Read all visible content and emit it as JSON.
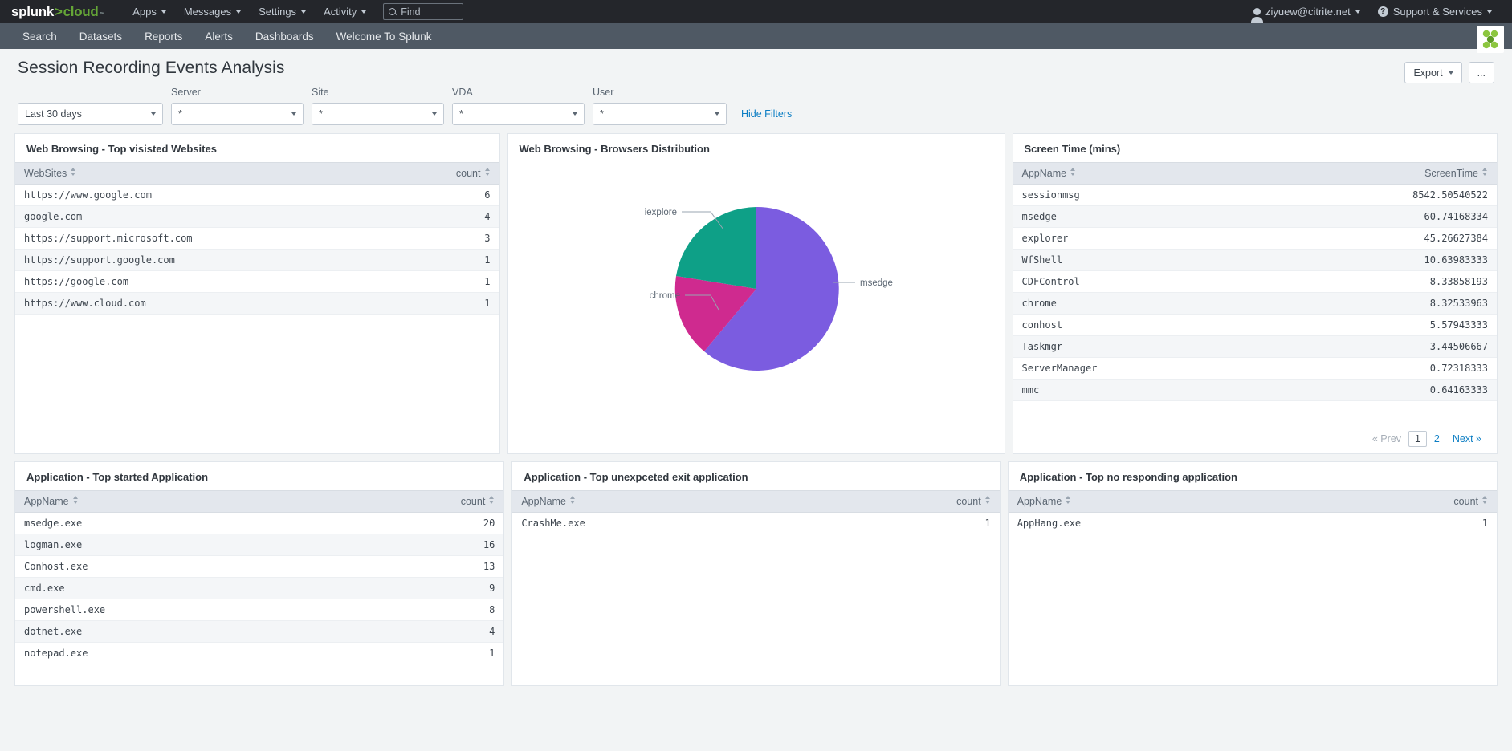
{
  "topbar": {
    "logo": {
      "part1": "splunk",
      "gt": ">",
      "part2": "cloud",
      "tm": "™"
    },
    "menus": [
      {
        "name": "apps",
        "label": "Apps"
      },
      {
        "name": "messages",
        "label": "Messages"
      },
      {
        "name": "settings",
        "label": "Settings"
      },
      {
        "name": "activity",
        "label": "Activity"
      }
    ],
    "find_placeholder": "Find",
    "user": "ziyuew@citrite.net",
    "support": "Support & Services"
  },
  "appnav": {
    "items": [
      {
        "name": "search",
        "label": "Search"
      },
      {
        "name": "datasets",
        "label": "Datasets"
      },
      {
        "name": "reports",
        "label": "Reports"
      },
      {
        "name": "alerts",
        "label": "Alerts"
      },
      {
        "name": "dashboards",
        "label": "Dashboards"
      },
      {
        "name": "welcome",
        "label": "Welcome To Splunk"
      }
    ]
  },
  "page": {
    "title": "Session Recording Events Analysis",
    "export_label": "Export",
    "more_label": "..."
  },
  "filters": {
    "time": {
      "label": "",
      "value": "Last 30 days"
    },
    "server": {
      "label": "Server",
      "value": "*"
    },
    "site": {
      "label": "Site",
      "value": "*"
    },
    "vda": {
      "label": "VDA",
      "value": "*"
    },
    "user": {
      "label": "User",
      "value": "*"
    },
    "hide_filters": "Hide Filters"
  },
  "panels": {
    "top_websites": {
      "title": "Web Browsing - Top visisted Websites",
      "columns": [
        "WebSites",
        "count"
      ],
      "rows": [
        [
          "https://www.google.com",
          "6"
        ],
        [
          "google.com",
          "4"
        ],
        [
          "https://support.microsoft.com",
          "3"
        ],
        [
          "https://support.google.com",
          "1"
        ],
        [
          "https://google.com",
          "1"
        ],
        [
          "https://www.cloud.com",
          "1"
        ]
      ]
    },
    "browsers": {
      "title": "Web Browsing - Browsers Distribution"
    },
    "screen_time": {
      "title": "Screen Time (mins)",
      "columns": [
        "AppName",
        "ScreenTime"
      ],
      "rows": [
        [
          "sessionmsg",
          "8542.50540522"
        ],
        [
          "msedge",
          "60.74168334"
        ],
        [
          "explorer",
          "45.26627384"
        ],
        [
          "WfShell",
          "10.63983333"
        ],
        [
          "CDFControl",
          "8.33858193"
        ],
        [
          "chrome",
          "8.32533963"
        ],
        [
          "conhost",
          "5.57943333"
        ],
        [
          "Taskmgr",
          "3.44506667"
        ],
        [
          "ServerManager",
          "0.72318333"
        ],
        [
          "mmc",
          "0.64163333"
        ]
      ],
      "pager": {
        "prev": "« Prev",
        "pages": [
          "1",
          "2"
        ],
        "current": "1",
        "next": "Next »"
      }
    },
    "top_started": {
      "title": "Application - Top started Application",
      "columns": [
        "AppName",
        "count"
      ],
      "rows": [
        [
          "msedge.exe",
          "20"
        ],
        [
          "logman.exe",
          "16"
        ],
        [
          "Conhost.exe",
          "13"
        ],
        [
          "cmd.exe",
          "9"
        ],
        [
          "powershell.exe",
          "8"
        ],
        [
          "dotnet.exe",
          "4"
        ],
        [
          "notepad.exe",
          "1"
        ]
      ]
    },
    "unexpected_exit": {
      "title": "Application - Top unexpceted exit application",
      "columns": [
        "AppName",
        "count"
      ],
      "rows": [
        [
          "CrashMe.exe",
          "1"
        ]
      ]
    },
    "no_responding": {
      "title": "Application - Top no responding application",
      "columns": [
        "AppName",
        "count"
      ],
      "rows": [
        [
          "AppHang.exe",
          "1"
        ]
      ]
    }
  },
  "chart_data": {
    "type": "pie",
    "title": "Web Browsing - Browsers Distribution",
    "categories": [
      "msedge",
      "chrome",
      "iexplore"
    ],
    "values": [
      9,
      4,
      4
    ],
    "labels_shown": [
      "iexplore",
      "chrome",
      "msedge"
    ],
    "colors": [
      "#7b5ce0",
      "#cf2a8f",
      "#0ea087"
    ],
    "legend": "callout-labels",
    "grid": false
  },
  "colors": {
    "accent": "#0c7ec4",
    "topbar_bg": "#24262b",
    "appbar_bg": "#4f5964",
    "brand_green": "#65a637"
  }
}
